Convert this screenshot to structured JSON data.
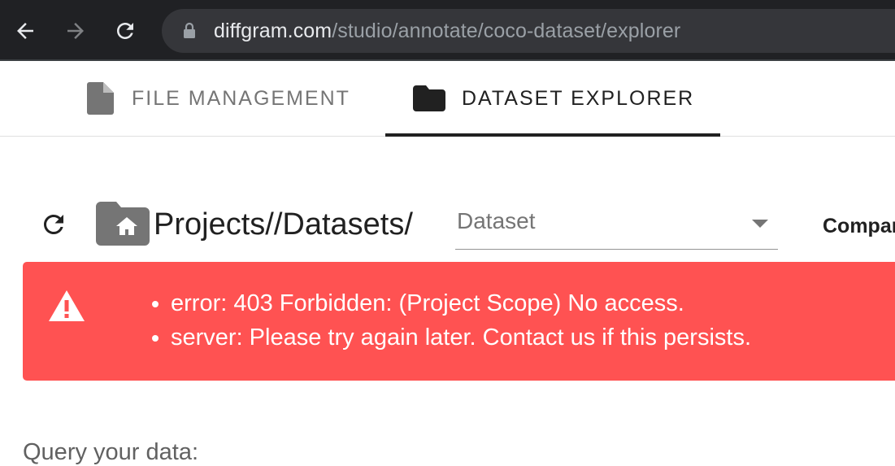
{
  "browser": {
    "url_host": "diffgram.com",
    "url_path": "/studio/annotate/coco-dataset/explorer",
    "icons": [
      "back-arrow-icon",
      "forward-arrow-icon",
      "reload-icon",
      "lock-icon"
    ]
  },
  "tabs": [
    {
      "label": "FILE MANAGEMENT",
      "icon": "file-icon",
      "active": false
    },
    {
      "label": "DATASET EXPLORER",
      "icon": "folder-icon",
      "active": true
    }
  ],
  "toolbar": {
    "breadcrumb": "Projects//Datasets/",
    "dataset_placeholder": "Dataset",
    "compare_label": "Compar"
  },
  "alert": {
    "color": "#ff5252",
    "messages": [
      "error: 403 Forbidden: (Project Scope) No access.",
      "server: Please try again later. Contact us if this persists."
    ]
  },
  "query": {
    "label": "Query your data:"
  }
}
